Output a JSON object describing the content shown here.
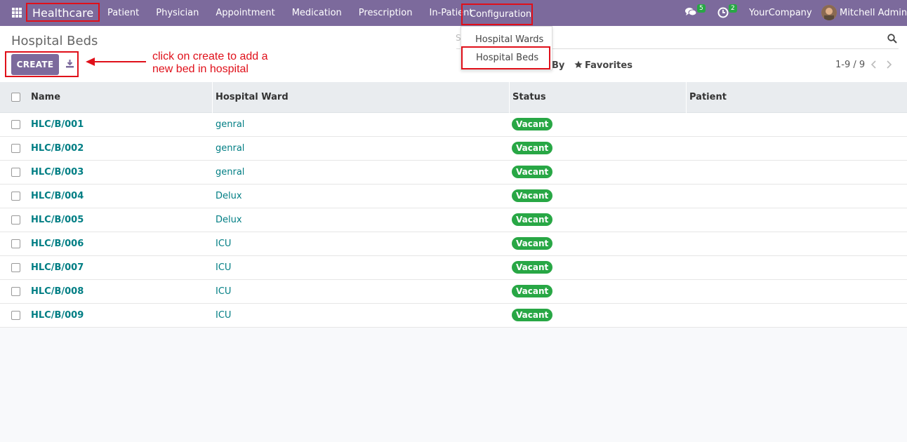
{
  "navbar": {
    "brand": "Healthcare",
    "menu": [
      "Patient",
      "Physician",
      "Appointment",
      "Medication",
      "Prescription",
      "In-Patient"
    ],
    "config_label": "Configuration",
    "chat_count": "5",
    "activity_count": "2",
    "company": "YourCompany",
    "user": "Mitchell Admin"
  },
  "control": {
    "title": "Hospital Beds",
    "search_placeholder": "S",
    "create_label": "CREATE",
    "group_by_label": "By",
    "favorites_label": "Favorites",
    "pager": "1-9 / 9"
  },
  "annotation": {
    "text_line1": "click on create to add a",
    "text_line2": "new bed in hospital"
  },
  "dropdown": {
    "items": [
      "Hospital Wards",
      "Hospital Beds"
    ]
  },
  "table": {
    "headers": {
      "name": "Name",
      "ward": "Hospital Ward",
      "status": "Status",
      "patient": "Patient"
    },
    "rows": [
      {
        "name": "HLC/B/001",
        "ward": "genral",
        "status": "Vacant",
        "patient": ""
      },
      {
        "name": "HLC/B/002",
        "ward": "genral",
        "status": "Vacant",
        "patient": ""
      },
      {
        "name": "HLC/B/003",
        "ward": "genral",
        "status": "Vacant",
        "patient": ""
      },
      {
        "name": "HLC/B/004",
        "ward": "Delux",
        "status": "Vacant",
        "patient": ""
      },
      {
        "name": "HLC/B/005",
        "ward": "Delux",
        "status": "Vacant",
        "patient": ""
      },
      {
        "name": "HLC/B/006",
        "ward": "ICU",
        "status": "Vacant",
        "patient": ""
      },
      {
        "name": "HLC/B/007",
        "ward": "ICU",
        "status": "Vacant",
        "patient": ""
      },
      {
        "name": "HLC/B/008",
        "ward": "ICU",
        "status": "Vacant",
        "patient": ""
      },
      {
        "name": "HLC/B/009",
        "ward": "ICU",
        "status": "Vacant",
        "patient": ""
      }
    ]
  },
  "colors": {
    "brand": "#7c6a9c",
    "link": "#017e84",
    "status_green": "#28a745",
    "highlight": "#e0101a"
  },
  "icons": [
    "apps-grid-icon",
    "chat-icon",
    "clock-icon",
    "search-icon",
    "download-icon",
    "star-icon",
    "chevron-left-icon",
    "chevron-right-icon"
  ]
}
